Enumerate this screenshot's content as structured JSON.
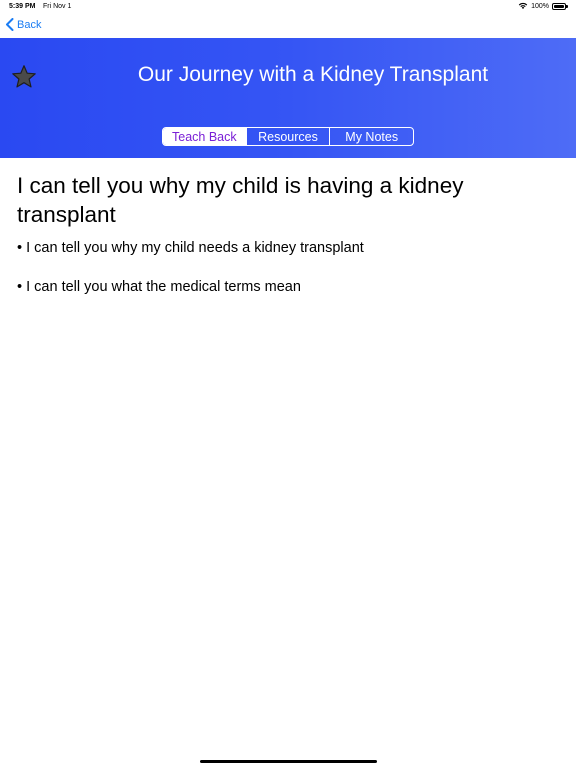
{
  "status_bar": {
    "time": "5:39 PM",
    "date": "Fri Nov 1",
    "battery": "100%",
    "wifi_icon": "wifi-icon",
    "battery_icon": "battery-icon"
  },
  "nav": {
    "back_label": "Back",
    "back_icon": "chevron-left-icon"
  },
  "header": {
    "title": "Our Journey with a Kidney Transplant",
    "star_icon": "star-icon",
    "tabs": [
      {
        "label": "Teach Back",
        "active": true
      },
      {
        "label": "Resources",
        "active": false
      },
      {
        "label": "My Notes",
        "active": false
      }
    ]
  },
  "content": {
    "heading": "I can tell you why my child is having a kidney transplant",
    "bullets": [
      "• I can tell you why my child needs a kidney transplant",
      "• I can tell you what the medical terms mean"
    ]
  },
  "colors": {
    "header_start": "#2a49f2",
    "header_end": "#4e6cf6",
    "accent_link": "#1a7cf3",
    "active_tab_text": "#7a1fd6"
  }
}
